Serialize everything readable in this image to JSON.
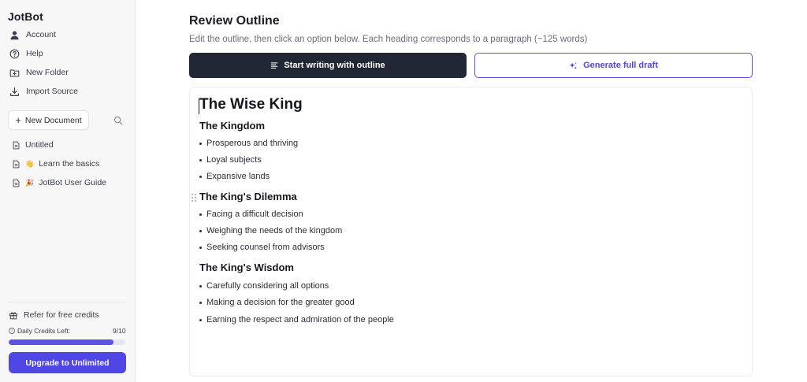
{
  "sidebar": {
    "brand": "JotBot",
    "nav": [
      {
        "label": "Account",
        "icon": "user-icon"
      },
      {
        "label": "Help",
        "icon": "help-circle-icon"
      },
      {
        "label": "New Folder",
        "icon": "folder-plus-icon"
      },
      {
        "label": "Import Source",
        "icon": "download-icon"
      }
    ],
    "new_document_label": "New Document",
    "documents": [
      {
        "label": "Untitled",
        "emoji": ""
      },
      {
        "label": "Learn the basics",
        "emoji": "👋"
      },
      {
        "label": "JotBot User Guide",
        "emoji": "🎉"
      }
    ],
    "refer_label": "Refer for free credits",
    "credits_label": "Daily Credits Left:",
    "credits_count": "9/10",
    "credits_fraction": 0.9,
    "upgrade_label": "Upgrade to Unlimited"
  },
  "main": {
    "title": "Review Outline",
    "subtitle": "Edit the outline, then click an option below. Each heading corresponds to a paragraph (~125 words)",
    "start_writing_label": "Start writing with outline",
    "generate_draft_label": "Generate full draft"
  },
  "outline": {
    "title": "The Wise King",
    "sections": [
      {
        "heading": "The Kingdom",
        "bullets": [
          "Prosperous and thriving",
          "Loyal subjects",
          "Expansive lands"
        ]
      },
      {
        "heading": "The King's Dilemma",
        "bullets": [
          "Facing a difficult decision",
          "Weighing the needs of the kingdom",
          "Seeking counsel from advisors"
        ]
      },
      {
        "heading": "The King's Wisdom",
        "bullets": [
          "Carefully considering all options",
          "Making a decision for the greater good",
          "Earning the respect and admiration of the people"
        ]
      }
    ]
  },
  "colors": {
    "accent": "#4f46e5",
    "dark_button": "#212734",
    "sidebar_bg": "#f7f7f8"
  }
}
